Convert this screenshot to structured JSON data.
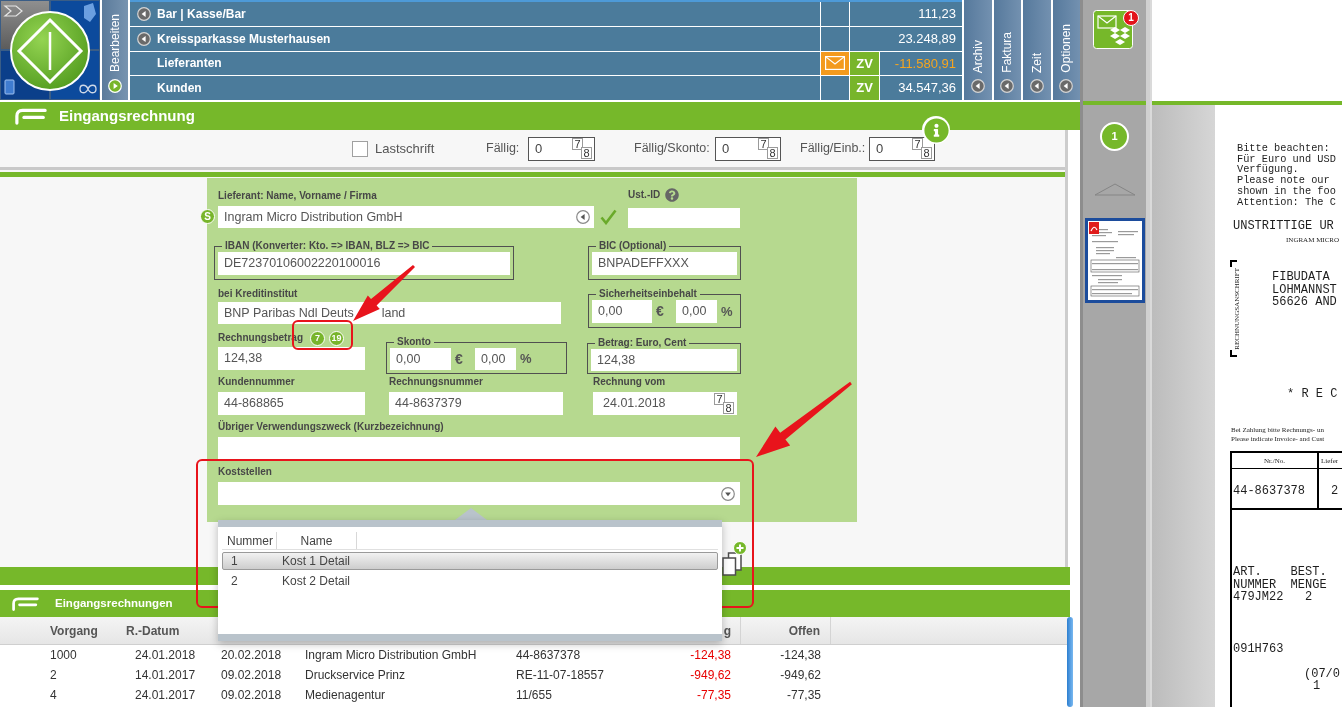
{
  "header": {
    "edit_tab": "Bearbeiten",
    "accounts": [
      {
        "name": "Bar | Kasse/Bar",
        "amount": "111,23",
        "expandable": true,
        "mail": false,
        "highlight": false
      },
      {
        "name": "Kreissparkasse Musterhausen",
        "amount": "23.248,89",
        "expandable": true,
        "mail": false,
        "highlight": false
      },
      {
        "name": "Lieferanten",
        "amount": "-11.580,91",
        "expandable": false,
        "mail": true,
        "badge": "ZV",
        "highlight": true
      },
      {
        "name": "Kunden",
        "amount": "34.547,36",
        "expandable": false,
        "mail": false,
        "badge": "ZV",
        "highlight": false
      }
    ],
    "side_tabs": [
      {
        "label": "Archiv"
      },
      {
        "label": "Faktura"
      },
      {
        "label": "Zeit"
      },
      {
        "label": "Optionen"
      }
    ]
  },
  "title": "Eingangsrechnung",
  "toolbar": {
    "direct_debit": {
      "label": "Lastschrift",
      "checked": false
    },
    "due_fields": [
      {
        "label": "Fällig:",
        "value": "0",
        "picker": [
          "7",
          "8"
        ]
      },
      {
        "label": "Fällig/Skonto:",
        "value": "0",
        "picker": [
          "7",
          "8"
        ]
      },
      {
        "label": "Fällig/Einb.:",
        "value": "0",
        "picker": [
          "7",
          "8"
        ]
      }
    ]
  },
  "form": {
    "supplier": {
      "label": "Lieferant: Name, Vorname / Firma",
      "badge": "S",
      "value": "Ingram Micro Distribution GmbH",
      "verified": true
    },
    "vat_id": {
      "label": "Ust.-ID"
    },
    "iban": {
      "label": "IBAN (Konverter: Kto. => IBAN, BLZ => BIC",
      "value": "DE72370106002220100016"
    },
    "bic": {
      "label": "BIC (Optional)",
      "value": "BNPADEFFXXX"
    },
    "bank": {
      "label": "bei Kreditinstitut",
      "value": [
        "BNP Paribas Ndl Deuts",
        "land"
      ]
    },
    "retention": {
      "label": "Sicherheitseinbehalt",
      "amount": "0,00",
      "currency": "€",
      "percent": "0,00",
      "unit": "%"
    },
    "invoice_amount": {
      "label": "Rechnungsbetrag",
      "tax_rates": [
        "7",
        "19"
      ],
      "value": "124,38"
    },
    "discount": {
      "label": "Skonto",
      "amount": "0,00",
      "currency": "€",
      "percent": "0,00",
      "unit": "%"
    },
    "payment_amount": {
      "label": "Betrag: Euro, Cent",
      "value": "124,38"
    },
    "customer_number": {
      "label": "Kundennummer",
      "value": "44-868865"
    },
    "invoice_number": {
      "label": "Rechnungsnummer",
      "value": "44-8637379"
    },
    "invoice_date": {
      "label": "Rechnung vom",
      "value": "24.01.2018",
      "picker": [
        "7",
        "8"
      ]
    },
    "purpose": {
      "label": "Übriger Verwendungszweck (Kurzbezeichnung)"
    },
    "cost_centers": {
      "label": "Koststellen",
      "expanded": true,
      "columns": [
        "Nummer",
        "Name"
      ],
      "options": [
        {
          "number": "1",
          "name": "Kost 1 Detail",
          "selected": true
        },
        {
          "number": "2",
          "name": "Kost 2 Detail",
          "selected": false
        }
      ]
    }
  },
  "invoice_list": {
    "title": "Eingangsrechnungen",
    "columns": [
      {
        "label": "Vorgang"
      },
      {
        "label": "R.-Datum"
      },
      {},
      {},
      {},
      {
        "label": "g"
      },
      {
        "label": "Offen"
      }
    ],
    "rows": [
      {
        "cells": [
          "1000",
          "24.01.2018",
          "20.02.2018",
          "Ingram Micro Distribution GmbH",
          "44-8637378",
          "-124,38",
          "-124,38"
        ],
        "overdue": true
      },
      {
        "cells": [
          "2",
          "14.01.2017",
          "09.02.2018",
          "Druckservice Prinz",
          "RE-11-07-18557",
          "-949,62",
          "-949,62"
        ],
        "overdue": true
      },
      {
        "cells": [
          "4",
          "24.01.2017",
          "09.02.2018",
          "Medienagentur",
          "11/655",
          "-77,35",
          "-77,35"
        ],
        "overdue": true
      }
    ]
  },
  "sidebar": {
    "inbox_badge": "1",
    "page_number": "1",
    "thumbnails": [
      {
        "selected": true
      }
    ]
  },
  "document": {
    "notice": [
      "Bitte beachten:",
      "Für Euro und USD",
      "Verfügung.",
      "Please note our",
      "shown in the foo",
      "Attention: The C"
    ],
    "heading": "UNSTRITTIGE UR",
    "sender": "INGRAM MICRO",
    "address_caption": "RECHNUNGSANSCHRIFT",
    "address": [
      "FIBUDATA",
      "LOHMANNST",
      "56626 AND"
    ],
    "doc_title": "* R E C",
    "payment_hint": [
      "Bei Zahlung bitte Rechnungs- un",
      "Please indicate Invoice- and Cust"
    ],
    "table": {
      "headers": [
        "Nr./No.",
        "Liefer"
      ],
      "cells": [
        "44-8637378",
        "2"
      ]
    },
    "items": [
      "ART.    BEST.",
      "NUMMER  MENGE",
      "479JM22   2"
    ],
    "code": "091H763",
    "footer": [
      "(07/0",
      "1"
    ]
  }
}
